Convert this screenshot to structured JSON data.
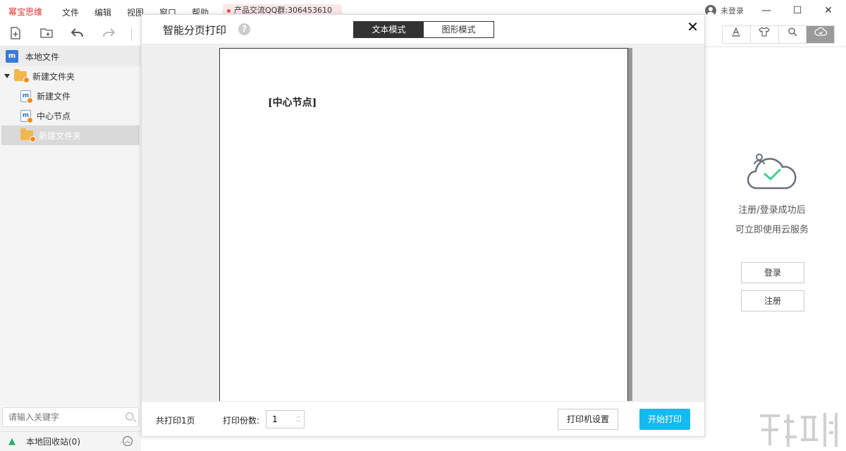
{
  "app": {
    "brand": "幂宝思维",
    "menu": [
      "文件",
      "编辑",
      "视图",
      "窗口",
      "帮助"
    ],
    "qq_badge": "产品交流QQ群:306453610",
    "user_status": "未登录"
  },
  "window_controls": {
    "minimize": "—",
    "maximize": "☐",
    "close": "✕"
  },
  "sidebar": {
    "local_files": "本地文件",
    "tree": [
      {
        "label": "新建文件夹",
        "type": "folder",
        "expanded": true
      },
      {
        "label": "新建文件",
        "type": "file"
      },
      {
        "label": "中心节点",
        "type": "file"
      },
      {
        "label": "新建文件夹",
        "type": "folder",
        "selected": true
      }
    ],
    "search_placeholder": "请输入关键字",
    "recycle_bin": "本地回收站(0)"
  },
  "dialog": {
    "title": "智能分页打印",
    "help": "?",
    "modes": [
      "文本模式",
      "图形模式"
    ],
    "active_mode": "文本模式",
    "page_text": "[中心节点]",
    "total_pages": "共打印1页",
    "copies_label": "打印份数:",
    "copies_value": "1",
    "printer_settings": "打印机设置",
    "start_print": "开始打印"
  },
  "right_panel": {
    "message_line1": "注册/登录成功后",
    "message_line2": "可立即使用云服务",
    "login": "登录",
    "register": "注册"
  }
}
